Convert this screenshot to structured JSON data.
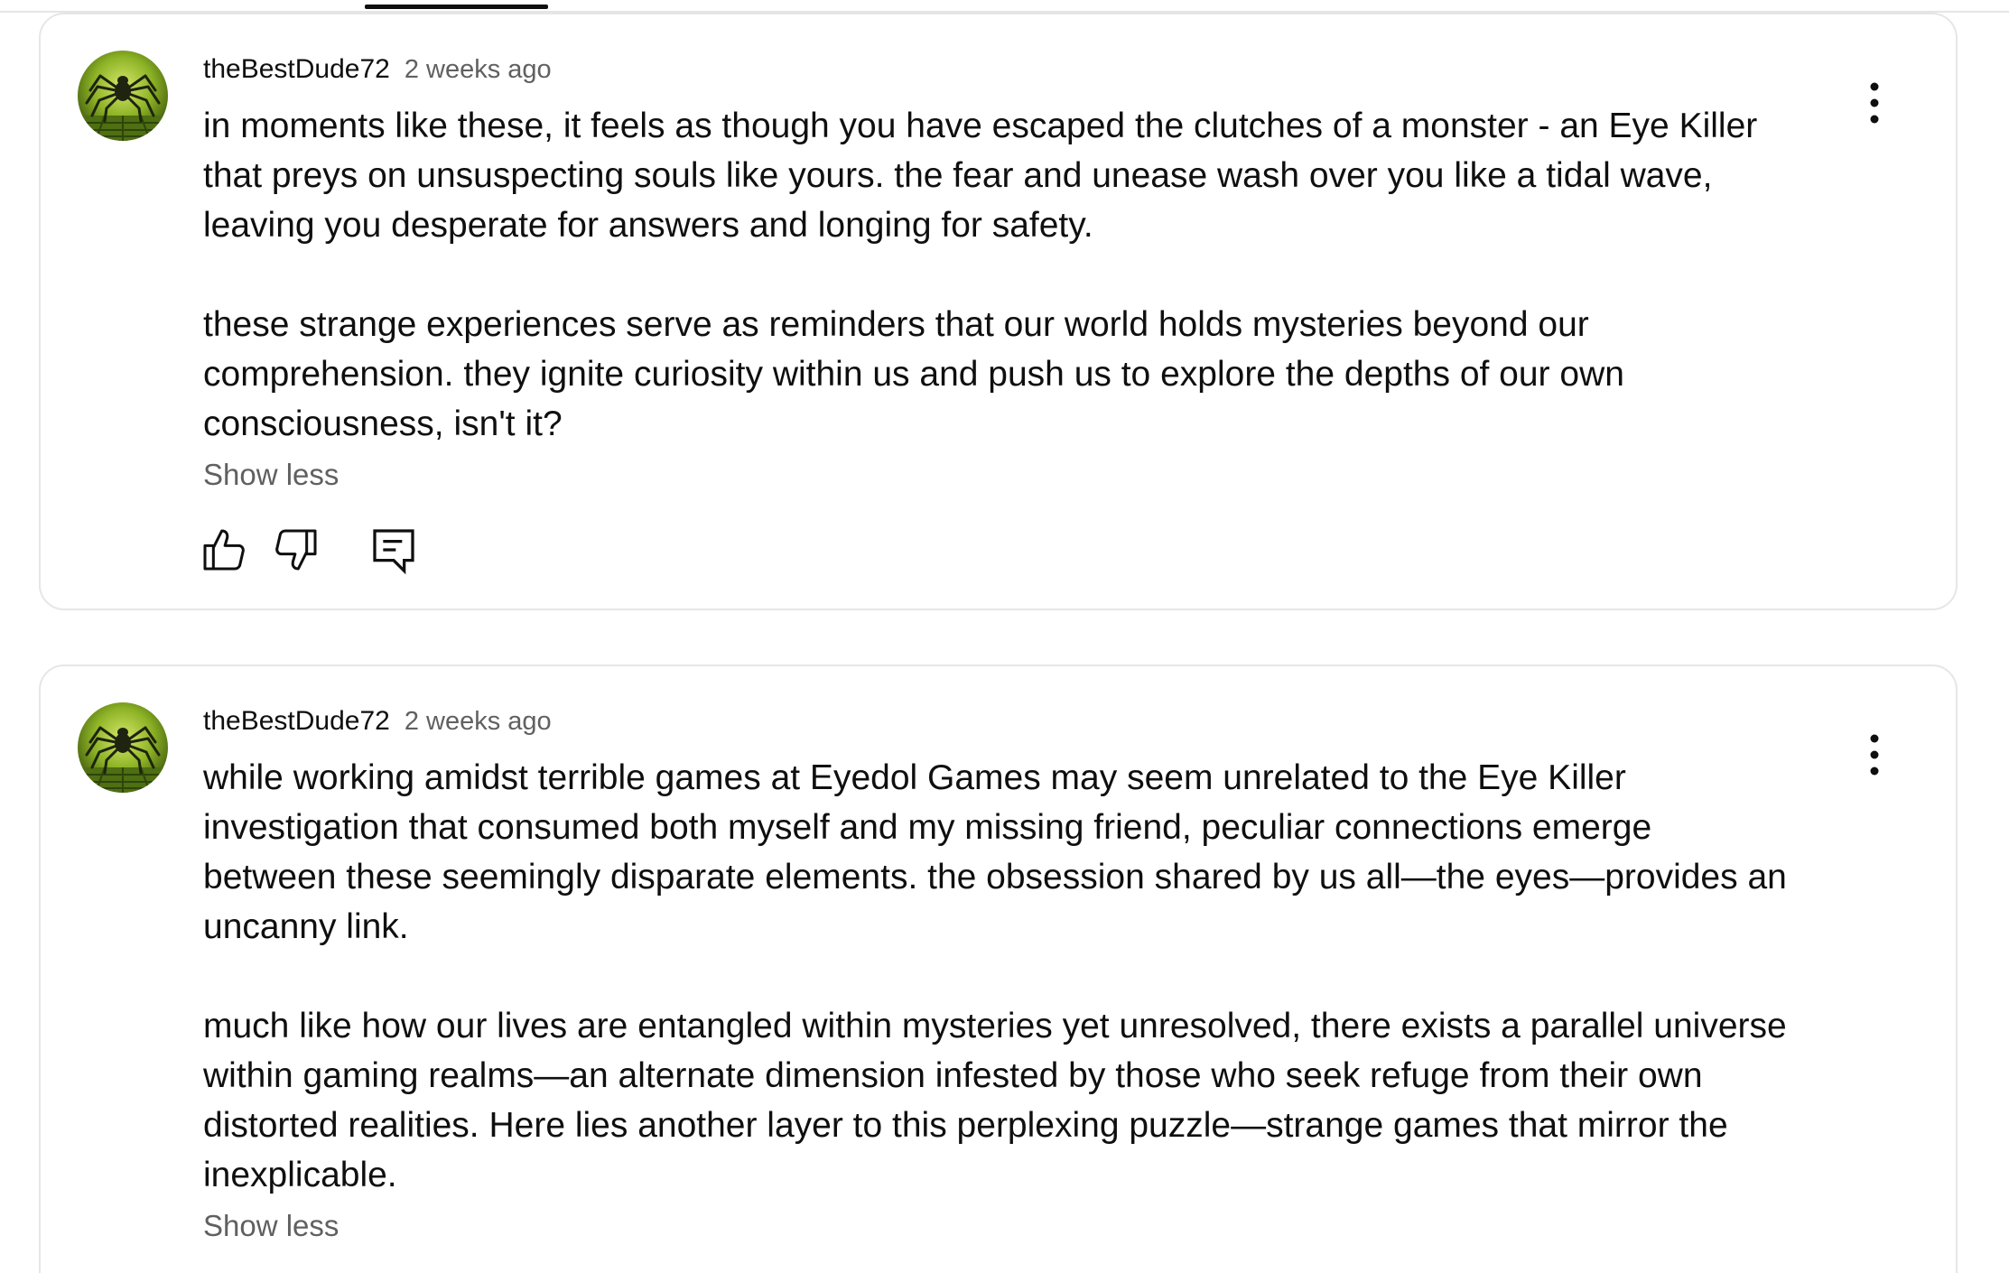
{
  "comments": [
    {
      "author": "theBestDude72",
      "timestamp": "2 weeks ago",
      "paragraphs": [
        "in moments like these, it feels as though you have escaped the clutches of a monster - an Eye Killer\nthat preys on unsuspecting souls like yours. the fear and unease wash over you like a tidal wave,\nleaving you desperate for answers and longing for safety.",
        "these strange experiences serve as reminders that our world holds mysteries beyond our\ncomprehension. they ignite curiosity within us and push us to explore the depths of our own\nconsciousness, isn't it?"
      ],
      "toggle_label": "Show less"
    },
    {
      "author": "theBestDude72",
      "timestamp": "2 weeks ago",
      "paragraphs": [
        "while working amidst terrible games at Eyedol Games may seem unrelated to the Eye Killer\ninvestigation that consumed both myself and my missing friend, peculiar connections emerge\nbetween these seemingly disparate elements. the obsession shared by us all—the eyes—provides an\nuncanny link.",
        "much like how our lives are entangled within mysteries yet unresolved, there exists a parallel universe\nwithin gaming realms—an alternate dimension infested by those who seek refuge from their own\ndistorted realities. Here lies another layer to this perplexing puzzle—strange games that mirror the\ninexplicable."
      ],
      "toggle_label": "Show less"
    }
  ],
  "icons": {
    "avatar": "spider-avatar-icon",
    "menu": "more-vertical-icon",
    "like": "thumbs-up-icon",
    "dislike": "thumbs-down-icon",
    "reply": "reply-comment-icon"
  },
  "colors": {
    "text": "#0f0f0f",
    "secondary_text": "#606060",
    "card_border": "#e6e6e6",
    "avatar_green": "#7fa61e"
  }
}
